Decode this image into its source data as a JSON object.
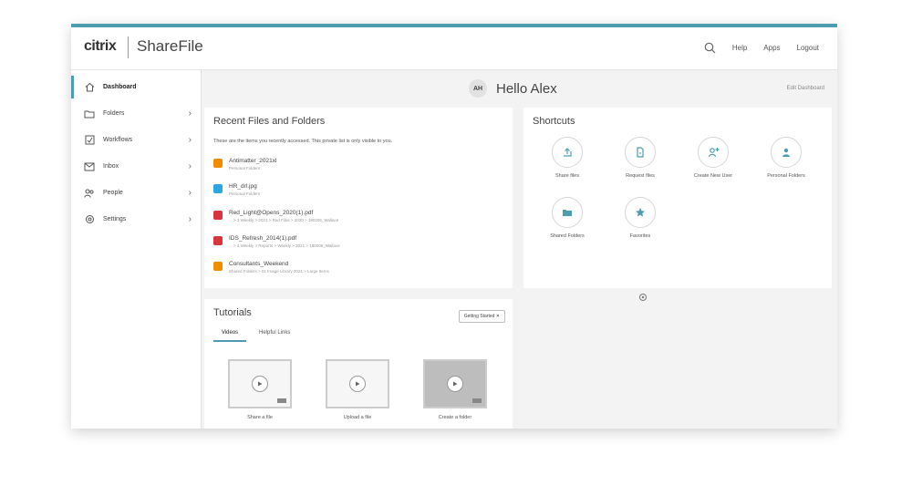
{
  "header": {
    "brand": "citrix",
    "product": "ShareFile",
    "actions": [
      "Help",
      "Apps",
      "Logout"
    ]
  },
  "sidebar": {
    "items": [
      {
        "label": "Dashboard",
        "icon": "home-icon",
        "active": true
      },
      {
        "label": "Folders",
        "icon": "folder-icon"
      },
      {
        "label": "Workflows",
        "icon": "workflow-icon"
      },
      {
        "label": "Inbox",
        "icon": "inbox-icon"
      },
      {
        "label": "People",
        "icon": "people-icon"
      },
      {
        "label": "Settings",
        "icon": "settings-icon"
      }
    ]
  },
  "greeting": {
    "initials": "AH",
    "text": "Hello Alex",
    "edit_label": "Edit Dashboard"
  },
  "recent": {
    "title": "Recent Files and Folders",
    "description": "These are the items you recently accessed. This private list is only visible to you.",
    "items": [
      {
        "name": "Antimatter_2021xl",
        "meta": "Personal Folders",
        "color": "#f08c00"
      },
      {
        "name": "HR_drl.jpg",
        "meta": "Personal Folders",
        "color": "#2aa7e0"
      },
      {
        "name": "Red_Light@Opens_2020(1).pdf",
        "meta": "... > 3 Weekly > 2021 > Red Files > 2020 > 190206_Wallace",
        "color": "#d9353f"
      },
      {
        "name": "IDS_Refresh_2014(1).pdf",
        "meta": "... > 4 Weekly > Reports > Weekly > 2021 > 190206_Wallace",
        "color": "#d9353f"
      },
      {
        "name": "Consultants_Weekend",
        "meta": "Shared Folders > 01 Image Library 2021 > Large Items",
        "color": "#f08c00"
      }
    ]
  },
  "shortcuts": {
    "title": "Shortcuts",
    "items": [
      {
        "label": "Share files",
        "icon": "share-files-icon"
      },
      {
        "label": "Request files",
        "icon": "request-files-icon"
      },
      {
        "label": "Create New User",
        "icon": "add-user-icon"
      },
      {
        "label": "Personal Folders",
        "icon": "personal-folders-icon"
      },
      {
        "label": "Shared Folders",
        "icon": "shared-folders-icon"
      },
      {
        "label": "Favorites",
        "icon": "favorites-icon"
      }
    ]
  },
  "tutorials": {
    "title": "Tutorials",
    "dismiss_label": "Getting Started",
    "tabs": [
      "Videos",
      "Helpful Links"
    ],
    "videos": [
      {
        "label": "Share a file"
      },
      {
        "label": "Upload a file"
      },
      {
        "label": "Create a folder"
      }
    ]
  },
  "colors": {
    "accent": "#4c9db0"
  }
}
